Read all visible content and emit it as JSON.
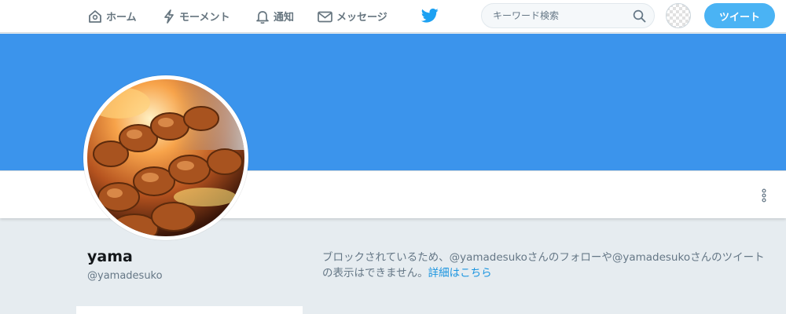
{
  "nav": {
    "home_label": "ホーム",
    "moments_label": "モーメント",
    "notifications_label": "通知",
    "messages_label": "メッセージ"
  },
  "search": {
    "placeholder": "キーワード検索"
  },
  "tweet_button_label": "ツイート",
  "profile": {
    "display_name": "yama",
    "screen_name": "@yamadesuko"
  },
  "blocked": {
    "message": "ブロックされているため、@yamadesukoさんのフォローや@yamadesukoさんのツイートの表示はできません。",
    "link_label": "詳細はこちら"
  },
  "colors": {
    "banner": "#3b94ec",
    "accent": "#1da1f2",
    "tweet_button": "#4ab3f4",
    "page_background": "#e6ecf0"
  },
  "icons": [
    "home-icon",
    "lightning-icon",
    "bell-icon",
    "envelope-icon",
    "twitter-bird-logo",
    "search-icon",
    "more-vertical-icon"
  ]
}
